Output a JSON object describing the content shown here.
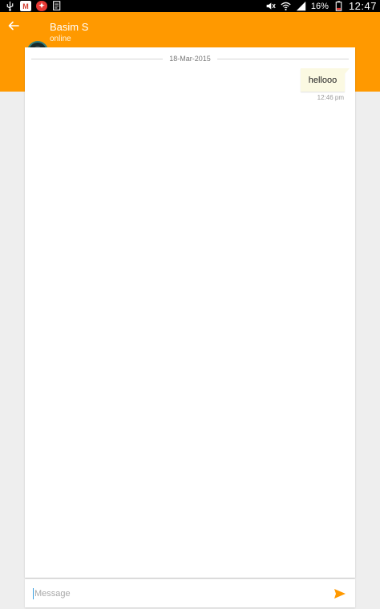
{
  "status_bar": {
    "battery_percent": "16%",
    "time": "12:47",
    "icons": [
      "usb-icon",
      "gmail-icon",
      "app-notification-icon",
      "document-icon",
      "mute-icon",
      "wifi-icon",
      "signal-icon",
      "battery-icon"
    ]
  },
  "header": {
    "contact_name": "Basim S",
    "contact_status": "online",
    "background_color": "#ff9900"
  },
  "chat": {
    "date_divider": "18-Mar-2015",
    "messages": [
      {
        "text": "hellooo",
        "time": "12:46 pm",
        "direction": "outgoing"
      }
    ]
  },
  "composer": {
    "placeholder": "Message",
    "value": "",
    "send_color": "#ff9900"
  }
}
